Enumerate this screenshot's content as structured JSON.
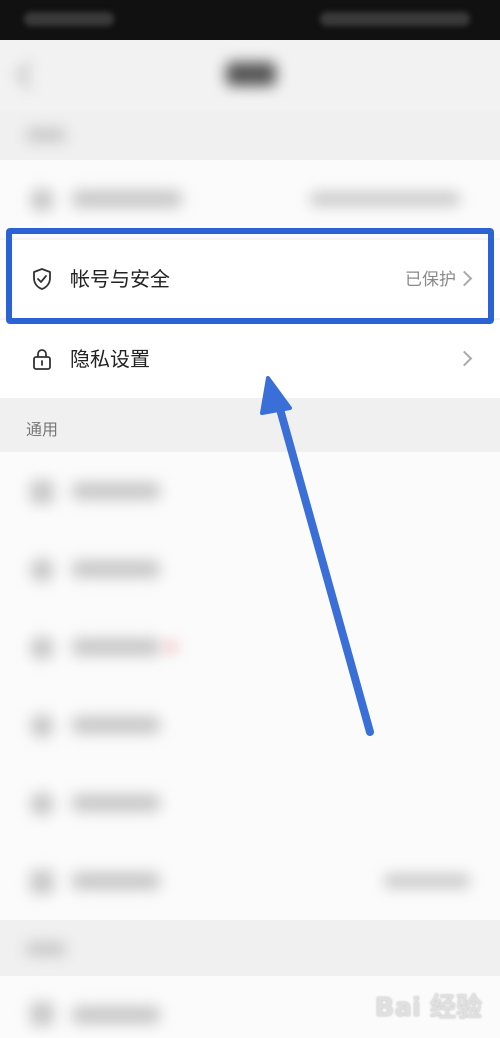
{
  "settings": {
    "security_row": {
      "label": "帐号与安全",
      "status": "已保护"
    },
    "privacy_row": {
      "label": "隐私设置"
    },
    "section_general": "通用"
  },
  "overlay": {
    "highlight_color": "#2c63d4",
    "arrow_color": "#3a6fd8"
  },
  "watermark": {
    "text": "Bai 经验"
  }
}
